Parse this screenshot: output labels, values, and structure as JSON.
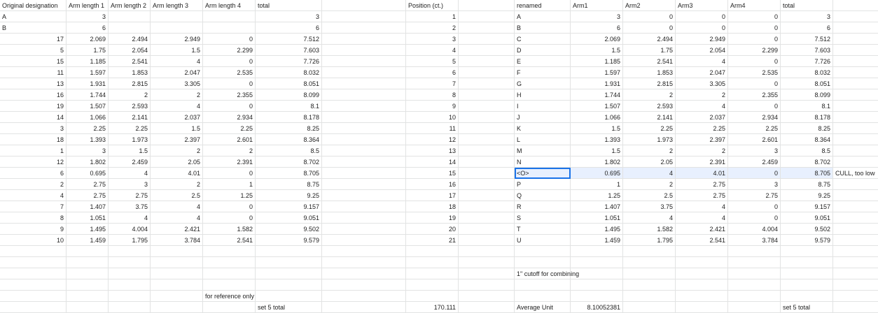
{
  "sheet": {
    "header": [
      "Original designation",
      "Arm length 1",
      "Arm length 2",
      "Arm length 3",
      "Arm length 4",
      "total",
      "",
      "Position (ct.)",
      "",
      "renamed",
      "Arm1",
      "Arm2",
      "Arm3",
      "Arm4",
      "total",
      "",
      ""
    ],
    "rows": [
      [
        "A",
        "3",
        "",
        "",
        "",
        "3",
        "",
        "1",
        "",
        "A",
        "3",
        "0",
        "0",
        "0",
        "3",
        "",
        ""
      ],
      [
        "B",
        "6",
        "",
        "",
        "",
        "6",
        "",
        "2",
        "",
        "B",
        "6",
        "0",
        "0",
        "0",
        "6",
        "",
        ""
      ],
      [
        "17",
        "2.069",
        "2.494",
        "2.949",
        "0",
        "7.512",
        "",
        "3",
        "",
        "C",
        "2.069",
        "2.494",
        "2.949",
        "0",
        "7.512",
        "",
        ""
      ],
      [
        "5",
        "1.75",
        "2.054",
        "1.5",
        "2.299",
        "7.603",
        "",
        "4",
        "",
        "D",
        "1.5",
        "1.75",
        "2.054",
        "2.299",
        "7.603",
        "",
        ""
      ],
      [
        "15",
        "1.185",
        "2.541",
        "4",
        "0",
        "7.726",
        "",
        "5",
        "",
        "E",
        "1.185",
        "2.541",
        "4",
        "0",
        "7.726",
        "",
        ""
      ],
      [
        "11",
        "1.597",
        "1.853",
        "2.047",
        "2.535",
        "8.032",
        "",
        "6",
        "",
        "F",
        "1.597",
        "1.853",
        "2.047",
        "2.535",
        "8.032",
        "",
        ""
      ],
      [
        "13",
        "1.931",
        "2.815",
        "3.305",
        "0",
        "8.051",
        "",
        "7",
        "",
        "G",
        "1.931",
        "2.815",
        "3.305",
        "0",
        "8.051",
        "",
        ""
      ],
      [
        "16",
        "1.744",
        "2",
        "2",
        "2.355",
        "8.099",
        "",
        "8",
        "",
        "H",
        "1.744",
        "2",
        "2",
        "2.355",
        "8.099",
        "",
        ""
      ],
      [
        "19",
        "1.507",
        "2.593",
        "4",
        "0",
        "8.1",
        "",
        "9",
        "",
        "I",
        "1.507",
        "2.593",
        "4",
        "0",
        "8.1",
        "",
        ""
      ],
      [
        "14",
        "1.066",
        "2.141",
        "2.037",
        "2.934",
        "8.178",
        "",
        "10",
        "",
        "J",
        "1.066",
        "2.141",
        "2.037",
        "2.934",
        "8.178",
        "",
        ""
      ],
      [
        "3",
        "2.25",
        "2.25",
        "1.5",
        "2.25",
        "8.25",
        "",
        "11",
        "",
        "K",
        "1.5",
        "2.25",
        "2.25",
        "2.25",
        "8.25",
        "",
        ""
      ],
      [
        "18",
        "1.393",
        "1.973",
        "2.397",
        "2.601",
        "8.364",
        "",
        "12",
        "",
        "L",
        "1.393",
        "1.973",
        "2.397",
        "2.601",
        "8.364",
        "",
        ""
      ],
      [
        "1",
        "3",
        "1.5",
        "2",
        "2",
        "8.5",
        "",
        "13",
        "",
        "M",
        "1.5",
        "2",
        "2",
        "3",
        "8.5",
        "",
        ""
      ],
      [
        "12",
        "1.802",
        "2.459",
        "2.05",
        "2.391",
        "8.702",
        "",
        "14",
        "",
        "N",
        "1.802",
        "2.05",
        "2.391",
        "2.459",
        "8.702",
        "",
        ""
      ],
      [
        "6",
        "0.695",
        "4",
        "4.01",
        "0",
        "8.705",
        "",
        "15",
        "",
        "<O>",
        "0.695",
        "4",
        "4.01",
        "0",
        "8.705",
        "CULL, too low",
        ""
      ],
      [
        "2",
        "2.75",
        "3",
        "2",
        "1",
        "8.75",
        "",
        "16",
        "",
        "P",
        "1",
        "2",
        "2.75",
        "3",
        "8.75",
        "",
        ""
      ],
      [
        "4",
        "2.75",
        "2.75",
        "2.5",
        "1.25",
        "9.25",
        "",
        "17",
        "",
        "Q",
        "1.25",
        "2.5",
        "2.75",
        "2.75",
        "9.25",
        "",
        ""
      ],
      [
        "7",
        "1.407",
        "3.75",
        "4",
        "0",
        "9.157",
        "",
        "18",
        "",
        "R",
        "1.407",
        "3.75",
        "4",
        "0",
        "9.157",
        "",
        ""
      ],
      [
        "8",
        "1.051",
        "4",
        "4",
        "0",
        "9.051",
        "",
        "19",
        "",
        "S",
        "1.051",
        "4",
        "4",
        "0",
        "9.051",
        "",
        ""
      ],
      [
        "9",
        "1.495",
        "4.004",
        "2.421",
        "1.582",
        "9.502",
        "",
        "20",
        "",
        "T",
        "1.495",
        "1.582",
        "2.421",
        "4.004",
        "9.502",
        "",
        ""
      ],
      [
        "10",
        "1.459",
        "1.795",
        "3.784",
        "2.541",
        "9.579",
        "",
        "21",
        "",
        "U",
        "1.459",
        "1.795",
        "2.541",
        "3.784",
        "9.579",
        "",
        ""
      ],
      [
        "",
        "",
        "",
        "",
        "",
        "",
        "",
        "",
        "",
        "",
        "",
        "",
        "",
        "",
        "",
        "",
        ""
      ],
      [
        "",
        "",
        "",
        "",
        "",
        "",
        "",
        "",
        "",
        "",
        "",
        "",
        "",
        "",
        "",
        "",
        ""
      ],
      [
        "",
        "",
        "",
        "",
        "",
        "",
        "",
        "",
        "",
        "1\" cutoff for combining",
        "",
        "",
        "",
        "",
        "",
        "",
        ""
      ],
      [
        "",
        "",
        "",
        "",
        "",
        "",
        "",
        "",
        "",
        "",
        "",
        "",
        "",
        "",
        "",
        "",
        ""
      ],
      [
        "",
        "",
        "",
        "",
        "for reference only",
        "",
        "",
        "",
        "",
        "",
        "",
        "",
        "",
        "",
        "",
        "",
        ""
      ],
      [
        "",
        "",
        "",
        "",
        "",
        "set 5 total",
        "",
        "170.111",
        "",
        "Average Unit",
        "8.10052381",
        "",
        "",
        "",
        "set 5 total",
        "",
        ""
      ]
    ]
  }
}
